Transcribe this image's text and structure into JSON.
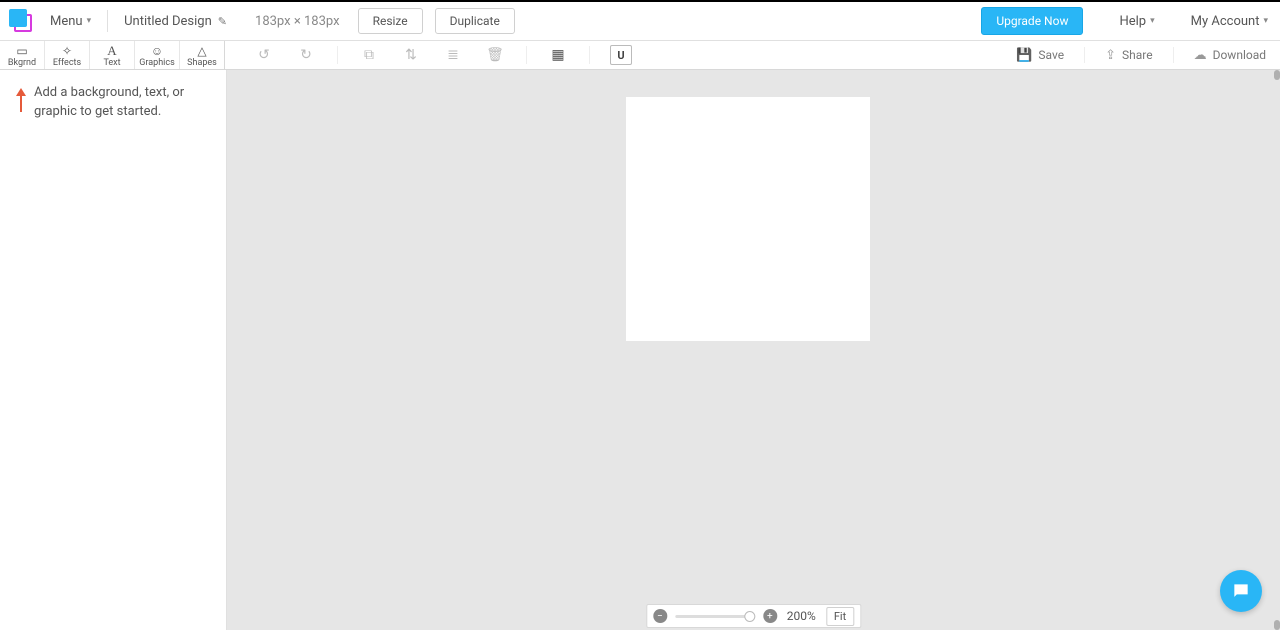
{
  "header": {
    "menu_label": "Menu",
    "design_title": "Untitled Design",
    "dimensions": "183px × 183px",
    "resize_label": "Resize",
    "duplicate_label": "Duplicate",
    "upgrade_label": "Upgrade Now",
    "help_label": "Help",
    "account_label": "My Account"
  },
  "tools": {
    "bkgrnd": "Bkgrnd",
    "effects": "Effects",
    "text": "Text",
    "graphics": "Graphics",
    "shapes": "Shapes"
  },
  "actions": {
    "save": "Save",
    "share": "Share",
    "download": "Download"
  },
  "hint": "Add a background, text, or graphic to get started.",
  "zoom": {
    "percent": "200%",
    "fit": "Fit"
  }
}
